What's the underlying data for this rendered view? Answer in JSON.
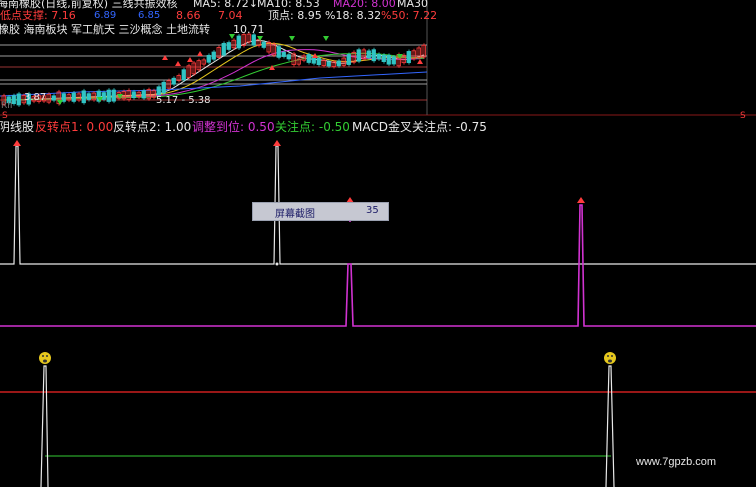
{
  "upper_panel": {
    "title_line": "海南橡胶(日线,前复权) 三线共振效核",
    "ma5": "MA5: 8.72↓",
    "ma10": "MA10: 8.53",
    "ma20": "MA20: 8.00",
    "ma30": "MA30",
    "support_label": "低点支撑: 7.16",
    "support_vals": [
      "6.89",
      "6.85"
    ],
    "support_vals2": [
      "8.66",
      "7.04"
    ],
    "top_label": "顶点: 8.95",
    "pct18": "%18: 8.32",
    "pct50": "%50: 7.22",
    "concepts": "橡胶 海南板块 军工航天 三沙概念 土地流转",
    "high_price": "10.71",
    "low_price": "3.87",
    "low_range": "5.17 - 5.38",
    "s_mark": "S",
    "left_fragment": "RII"
  },
  "indicator_header": {
    "name": "阴线股",
    "rev1": "反转点1: 0.00",
    "rev2": "反转点2: 1.00",
    "adjust": "调整到位: 0.50",
    "attention": "关注点: -0.50",
    "macd": "MACD金叉关注点: -0.75"
  },
  "tooltip": {
    "label": "屏幕截图",
    "value": "35"
  },
  "watermark": "www.7gpzb.com",
  "colors": {
    "up": "#ff3c3c",
    "down": "#31c4c4",
    "magenta": "#d233d2",
    "white": "#e8e8e8",
    "green": "#33cc33",
    "yellow": "#e6c81e",
    "red_line": "#cc1f1f"
  }
}
